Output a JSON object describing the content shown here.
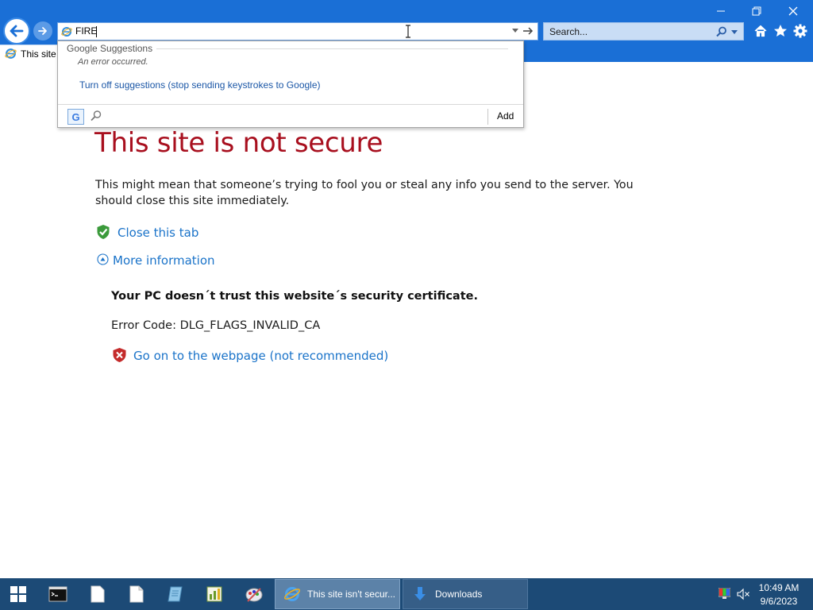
{
  "browser": {
    "address_value": "FIRE",
    "search_placeholder": "Search...",
    "tab_label": "This site"
  },
  "suggestions": {
    "title": "Google Suggestions",
    "error": "An error occurred.",
    "turn_off_link": "Turn off suggestions (stop sending keystrokes to Google)",
    "add_label": "Add",
    "provider_letter": "G"
  },
  "page": {
    "heading": "This site is not secure",
    "description": "This might mean that someone’s trying to fool you or steal any info you send to the server. You should close this site immediately.",
    "close_tab_link": "Close this tab",
    "more_info_link": "More information",
    "trust_message": "Your PC doesn´t trust this website´s security certificate.",
    "error_code": "Error Code: DLG_FLAGS_INVALID_CA",
    "go_on_link": "Go on to the webpage (not recommended)"
  },
  "taskbar": {
    "apps": [
      "start-icon",
      "cmd-icon",
      "document-icon",
      "document-icon",
      "notepad-icon",
      "chart-icon",
      "paint-icon"
    ],
    "tasks": [
      {
        "label": "This site isn't secur...",
        "icon": "ie-icon",
        "active": true
      },
      {
        "label": "Downloads",
        "icon": "download-arrow-icon",
        "active": false
      }
    ],
    "time": "10:49 AM",
    "date": "9/6/2023"
  },
  "colors": {
    "chrome_blue": "#1a6fd6",
    "heading_red": "#a80f1e",
    "link_blue": "#1a73c9",
    "taskbar": "#1c4a76"
  }
}
